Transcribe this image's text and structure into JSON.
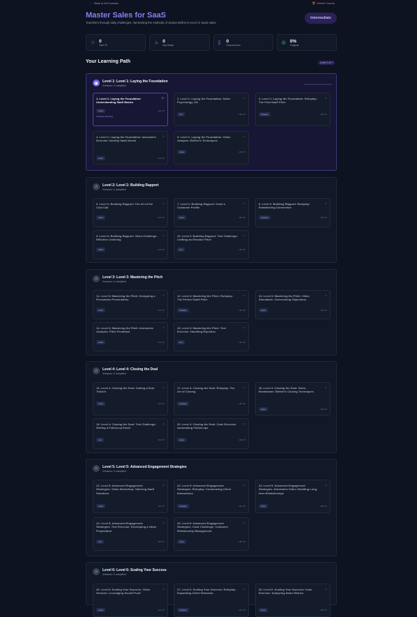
{
  "header": {
    "back_label": "Back to All Courses",
    "delete_label": "Delete Course",
    "title": "Master Sales for SaaS",
    "subtitle": "Transform through daily challenges, harnessing the methods of Jordan Belfort to excel in SaaS sales.",
    "difficulty": "Intermediate"
  },
  "stats": [
    {
      "value": "0",
      "label": "Total XP",
      "icon": "star-icon"
    },
    {
      "value": "0",
      "label": "Day Streak",
      "icon": "flame-icon"
    },
    {
      "value": "0",
      "label": "Lessons Done",
      "icon": "book-icon"
    },
    {
      "value": "0%",
      "label": "Progress",
      "icon": "target-icon"
    }
  ],
  "path": {
    "title": "Your Learning Path",
    "badge": "Level 1 of 7"
  },
  "levels": [
    {
      "title": "Level 1: Level 1: Laying the Foundation",
      "sub": "5 lessons • 0 completed",
      "lessons": [
        {
          "title": "1. Level 1: Laying the Foundation: Understanding SaaS Basics",
          "tag": "video",
          "xp": "100 XP",
          "cont": "Continue learning"
        },
        {
          "title": "2. Level 1: Laying the Foundation: Sales Psychology 101",
          "tag": "text",
          "xp": "100 XP"
        },
        {
          "title": "3. Level 1: Laying the Foundation: Roleplay: The First SaaS Pitch",
          "tag": "roleplay",
          "xp": "150 XP"
        },
        {
          "title": "4. Level 1: Laying the Foundation: Interactive Exercise: Identify SaaS Needs",
          "tag": "code",
          "xp": "120 XP"
        },
        {
          "title": "5. Level 1: Laying the Foundation: Video Analysis: Belfort's Techniques",
          "tag": "video",
          "xp": "100 XP"
        }
      ]
    },
    {
      "title": "Level 2: Level 2: Building Rapport",
      "sub": "5 lessons • 0 completed",
      "lessons": [
        {
          "title": "6. Level 2: Building Rapport: The Art of the Cold Call",
          "tag": "video",
          "xp": "120 XP"
        },
        {
          "title": "7. Level 2: Building Rapport: Code a Customer Profile",
          "tag": "code",
          "xp": "150 XP"
        },
        {
          "title": "8. Level 2: Building Rapport: Roleplay: Establishing Connection",
          "tag": "roleplay",
          "xp": "150 XP"
        },
        {
          "title": "9. Level 2: Building Rapport: Video Challenge: Effective Listening",
          "tag": "video",
          "xp": "120 XP"
        },
        {
          "title": "10. Level 2: Building Rapport: Text Challenge: Crafting an Elevator Pitch",
          "tag": "text",
          "xp": "100 XP"
        }
      ]
    },
    {
      "title": "Level 3: Level 3: Mastering the Pitch",
      "sub": "5 lessons • 0 completed",
      "lessons": [
        {
          "title": "11. Level 3: Mastering the Pitch: Designing a Persuasive Presentation",
          "tag": "code",
          "xp": "140 XP"
        },
        {
          "title": "12. Level 3: Mastering the Pitch: Roleplay: The Perfect SaaS Pitch",
          "tag": "roleplay",
          "xp": "160 XP"
        },
        {
          "title": "13. Level 3: Mastering the Pitch: Video Simulation: Overcoming Objections",
          "tag": "video",
          "xp": "140 XP"
        },
        {
          "title": "14. Level 3: Mastering the Pitch: Interactive Analysis: Pitch Feedback",
          "tag": "video",
          "xp": "140 XP"
        },
        {
          "title": "15. Level 3: Mastering the Pitch: Text Exercise: Handling Rejection",
          "tag": "text",
          "xp": "140 XP"
        }
      ]
    },
    {
      "title": "Level 4: Level 4: Closing the Deal",
      "sub": "5 lessons • 0 completed",
      "lessons": [
        {
          "title": "16. Level 4: Closing the Deal: Coding a Deal Tracker",
          "tag": "code",
          "xp": "160 XP"
        },
        {
          "title": "17. Level 4: Closing the Deal: Roleplay: The Art of Closing",
          "tag": "roleplay",
          "xp": "180 XP"
        },
        {
          "title": "18. Level 4: Closing the Deal: Video Breakdown: Belfort's Closing Techniques",
          "tag": "video",
          "xp": "160 XP"
        },
        {
          "title": "19. Level 4: Closing the Deal: Text Challenge: Writing a Follow-up Email",
          "tag": "text",
          "xp": "160 XP"
        },
        {
          "title": "20. Level 4: Closing the Deal: Code Exercise: Automating Follow-ups",
          "tag": "code",
          "xp": "160 XP"
        }
      ]
    },
    {
      "title": "Level 5: Level 5: Advanced Engagement Strategies",
      "sub": "5 lessons • 0 completed",
      "lessons": [
        {
          "title": "21. Level 5: Advanced Engagement Strategies: Video Workshop: Tailoring SaaS Solutions",
          "tag": "video",
          "xp": "180 XP"
        },
        {
          "title": "22. Level 5: Advanced Engagement Strategies: Roleplay: Customizing Client Interactions",
          "tag": "roleplay",
          "xp": "200 XP"
        },
        {
          "title": "23. Level 5: Advanced Engagement Strategies: Interactive Video: Building Long-term Relationships",
          "tag": "video",
          "xp": "180 XP"
        },
        {
          "title": "24. Level 5: Advanced Engagement Strategies: Text Exercise: Developing a Value Proposition",
          "tag": "text",
          "xp": "180 XP"
        },
        {
          "title": "25. Level 5: Advanced Engagement Strategies: Code Challenge: Customer Relationship Management",
          "tag": "code",
          "xp": "180 XP"
        }
      ]
    },
    {
      "title": "Level 6: Level 6: Scaling Your Success",
      "sub": "5 lessons • 0 completed",
      "lessons": [
        {
          "title": "26. Level 6: Scaling Your Success: Video Session: Leveraging Social Proof",
          "tag": "video",
          "xp": "200 XP"
        },
        {
          "title": "27. Level 6: Scaling Your Success: Roleplay: Expanding Client Networks",
          "tag": "roleplay",
          "xp": "220 XP"
        },
        {
          "title": "28. Level 6: Scaling Your Success: Code Exercise: Analyzing Sales Metrics",
          "tag": "code",
          "xp": "200 XP"
        }
      ]
    }
  ]
}
